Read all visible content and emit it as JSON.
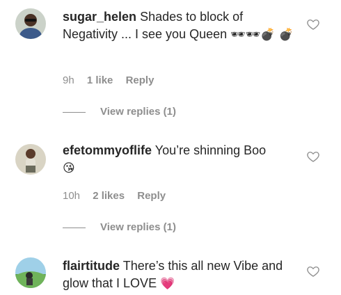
{
  "comments": [
    {
      "username": "sugar_helen",
      "text": "Shades to block of Negativity ... I see you Queen",
      "emoji": "🕶🕶💣 💣",
      "time": "9h",
      "likes": "1 like",
      "reply": "Reply",
      "view_replies": "View replies (1)",
      "liked": false
    },
    {
      "username": "efetommyoflife",
      "text": "You’re shinning Boo",
      "emoji": "😘",
      "time": "10h",
      "likes": "2 likes",
      "reply": "Reply",
      "view_replies": "View replies (1)",
      "liked": false
    },
    {
      "username": "flairtitude",
      "text": "There’s this all new Vibe and glow that I LOVE",
      "emoji": "💗",
      "liked": false
    }
  ],
  "icons": {
    "like": "heart-outline-icon"
  },
  "colors": {
    "text": "#262626",
    "muted": "#8e8e8e",
    "background": "#ffffff"
  }
}
